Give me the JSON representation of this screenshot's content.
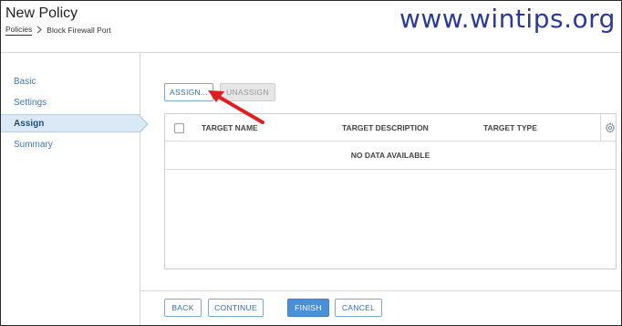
{
  "header": {
    "title": "New Policy",
    "breadcrumb": {
      "parent": "Policies",
      "current": "Block Firewall Port"
    }
  },
  "watermark": "www.wintips.org",
  "sidebar": {
    "items": [
      {
        "label": "Basic"
      },
      {
        "label": "Settings"
      },
      {
        "label": "Assign",
        "active": true
      },
      {
        "label": "Summary"
      }
    ]
  },
  "toolbar": {
    "assign_label": "ASSIGN...",
    "unassign_label": "UNASSIGN"
  },
  "table": {
    "columns": [
      "TARGET NAME",
      "TARGET DESCRIPTION",
      "TARGET TYPE"
    ],
    "empty_message": "NO DATA AVAILABLE"
  },
  "footer": {
    "back_label": "BACK",
    "continue_label": "CONTINUE",
    "finish_label": "FINISH",
    "cancel_label": "CANCEL"
  },
  "icons": {
    "breadcrumb_separator": "chevron-right-icon",
    "table_settings": "gear-icon",
    "annotation": "red-arrow-icon"
  },
  "colors": {
    "accent": "#4a90d9",
    "link": "#3c78b4",
    "active_nav_bg": "#dbe9f6",
    "annotation": "#e02020",
    "watermark": "#2a3a9b"
  }
}
